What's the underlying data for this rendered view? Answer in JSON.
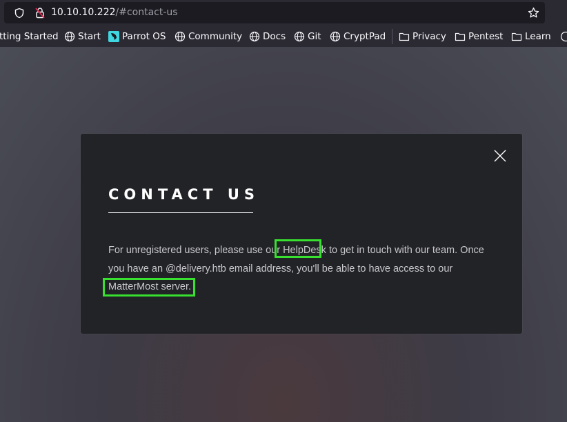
{
  "browser": {
    "url_host": "10.10.10.222",
    "url_path": "/#contact-us"
  },
  "bookmarks": [
    {
      "label": "tting Started",
      "icon": "none"
    },
    {
      "label": "Start",
      "icon": "globe-icon"
    },
    {
      "label": "Parrot OS",
      "icon": "parrot-icon"
    },
    {
      "label": "Community",
      "icon": "globe-icon"
    },
    {
      "label": "Docs",
      "icon": "globe-icon"
    },
    {
      "label": "Git",
      "icon": "globe-icon"
    },
    {
      "label": "CryptPad",
      "icon": "globe-icon"
    },
    {
      "label": "Privacy",
      "icon": "folder-icon"
    },
    {
      "label": "Pentest",
      "icon": "folder-icon"
    },
    {
      "label": "Learn",
      "icon": "folder-icon"
    }
  ],
  "modal": {
    "title": "CONTACT US",
    "text_part1": "For unregistered users, please use our ",
    "helpdesk_link": "HelpDesk",
    "text_part2": " to get in touch with our team. Once you have an @delivery.htb email address, you'll be able to have access to our ",
    "mattermost_link": "MatterMost server."
  },
  "colors": {
    "highlight": "#38e030",
    "modal_bg": "#222327",
    "browser_bg": "#2b2a33"
  }
}
